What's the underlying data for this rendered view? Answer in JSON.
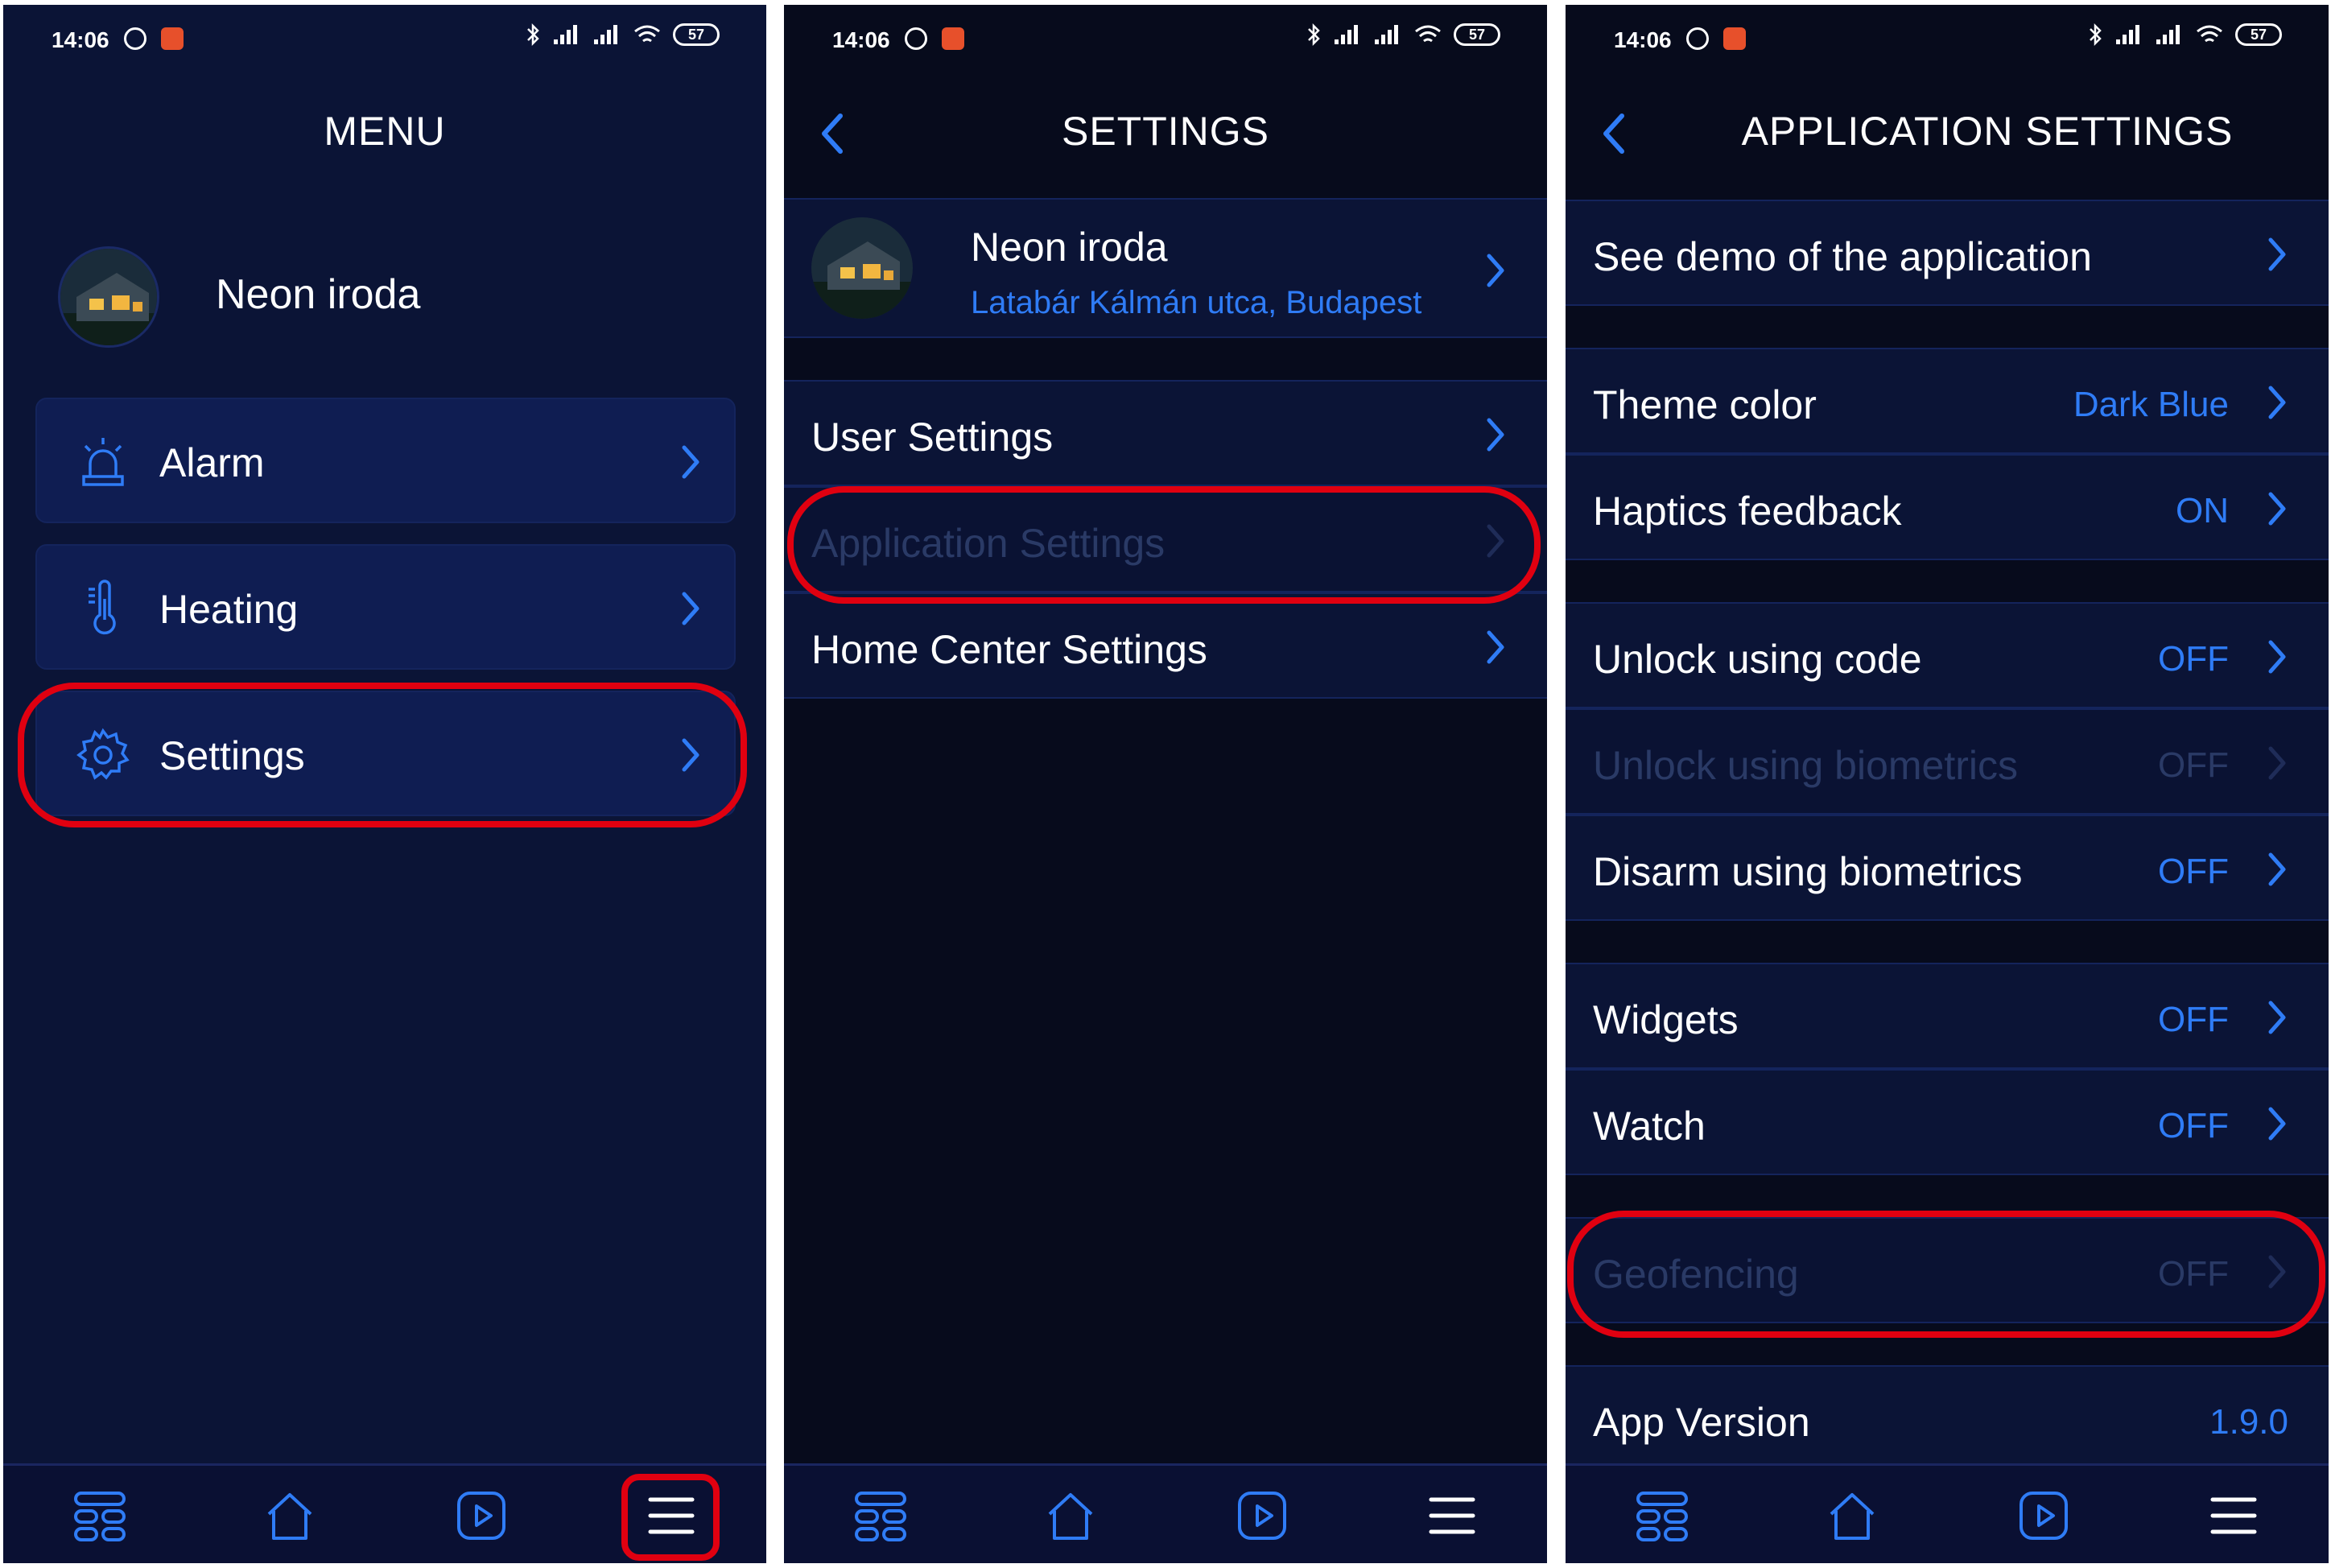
{
  "status": {
    "time": "14:06",
    "battery": "57"
  },
  "screen1": {
    "title": "MENU",
    "profile_name": "Neon iroda",
    "items": [
      {
        "label": "Alarm",
        "icon": "alarm-siren-icon"
      },
      {
        "label": "Heating",
        "icon": "thermometer-icon"
      },
      {
        "label": "Settings",
        "icon": "gear-icon"
      }
    ]
  },
  "screen2": {
    "title": "SETTINGS",
    "location_name": "Neon iroda",
    "location_address": "Latabár Kálmán utca, Budapest",
    "items": [
      {
        "label": "User Settings",
        "disabled": false
      },
      {
        "label": "Application Settings",
        "disabled": true
      },
      {
        "label": "Home Center Settings",
        "disabled": false
      }
    ]
  },
  "screen3": {
    "title": "APPLICATION SETTINGS",
    "rows": [
      {
        "label": "See demo of the application",
        "value": ""
      },
      {
        "label": "Theme color",
        "value": "Dark Blue"
      },
      {
        "label": "Haptics feedback",
        "value": "ON"
      },
      {
        "label": "Unlock using code",
        "value": "OFF"
      },
      {
        "label": "Unlock using biometrics",
        "value": "OFF",
        "disabled": true
      },
      {
        "label": "Disarm using biometrics",
        "value": "OFF"
      },
      {
        "label": "Widgets",
        "value": "OFF"
      },
      {
        "label": "Watch",
        "value": "OFF"
      },
      {
        "label": "Geofencing",
        "value": "OFF",
        "disabled": true
      },
      {
        "label": "App Version",
        "value": "1.9.0"
      }
    ]
  },
  "tabbar": [
    "rooms-icon",
    "home-icon",
    "scenes-play-icon",
    "menu-icon"
  ],
  "colors": {
    "accent": "#2f7cf6",
    "highlight": "#e00010",
    "bg": "#0b1436"
  }
}
